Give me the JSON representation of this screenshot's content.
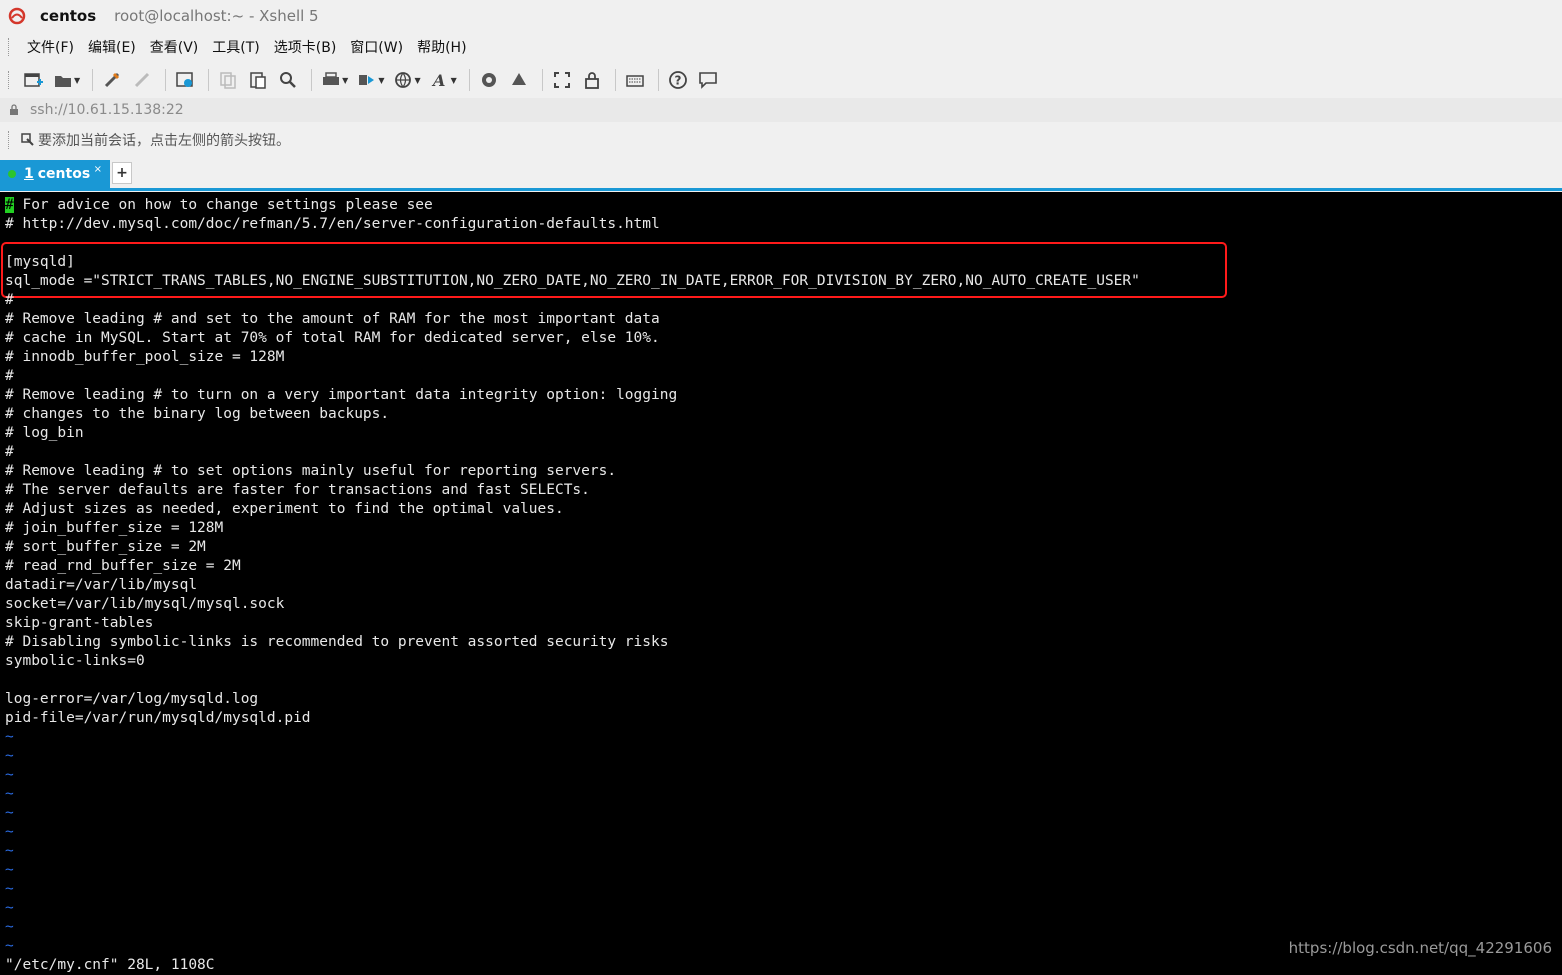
{
  "window": {
    "host": "centos",
    "title": "root@localhost:~ - Xshell 5"
  },
  "menu": [
    "文件(F)",
    "编辑(E)",
    "查看(V)",
    "工具(T)",
    "选项卡(B)",
    "窗口(W)",
    "帮助(H)"
  ],
  "address": "ssh://10.61.15.138:22",
  "session_hint": "要添加当前会话，点击左侧的箭头按钮。",
  "tab": {
    "number": "1",
    "label": "centos",
    "close": "×",
    "add": "+"
  },
  "terminal": {
    "lines": [
      "# For advice on how to change settings please see",
      "# http://dev.mysql.com/doc/refman/5.7/en/server-configuration-defaults.html",
      "",
      "[mysqld]",
      "sql_mode =\"STRICT_TRANS_TABLES,NO_ENGINE_SUBSTITUTION,NO_ZERO_DATE,NO_ZERO_IN_DATE,ERROR_FOR_DIVISION_BY_ZERO,NO_AUTO_CREATE_USER\"",
      "#",
      "# Remove leading # and set to the amount of RAM for the most important data",
      "# cache in MySQL. Start at 70% of total RAM for dedicated server, else 10%.",
      "# innodb_buffer_pool_size = 128M",
      "#",
      "# Remove leading # to turn on a very important data integrity option: logging",
      "# changes to the binary log between backups.",
      "# log_bin",
      "#",
      "# Remove leading # to set options mainly useful for reporting servers.",
      "# The server defaults are faster for transactions and fast SELECTs.",
      "# Adjust sizes as needed, experiment to find the optimal values.",
      "# join_buffer_size = 128M",
      "# sort_buffer_size = 2M",
      "# read_rnd_buffer_size = 2M",
      "datadir=/var/lib/mysql",
      "socket=/var/lib/mysql/mysql.sock",
      "skip-grant-tables",
      "# Disabling symbolic-links is recommended to prevent assorted security risks",
      "symbolic-links=0",
      "",
      "log-error=/var/log/mysqld.log",
      "pid-file=/var/run/mysqld/mysqld.pid",
      "~",
      "~",
      "~",
      "~",
      "~",
      "~",
      "~",
      "~",
      "~",
      "~",
      "~",
      "~",
      "\"/etc/my.cnf\" 28L, 1108C"
    ]
  },
  "watermark": "https://blog.csdn.net/qq_42291606",
  "colors": {
    "tab_active": "#1a98d5",
    "cursor": "#22d022",
    "tilde": "#2a6ae0",
    "highlight": "#ff1a1a"
  }
}
